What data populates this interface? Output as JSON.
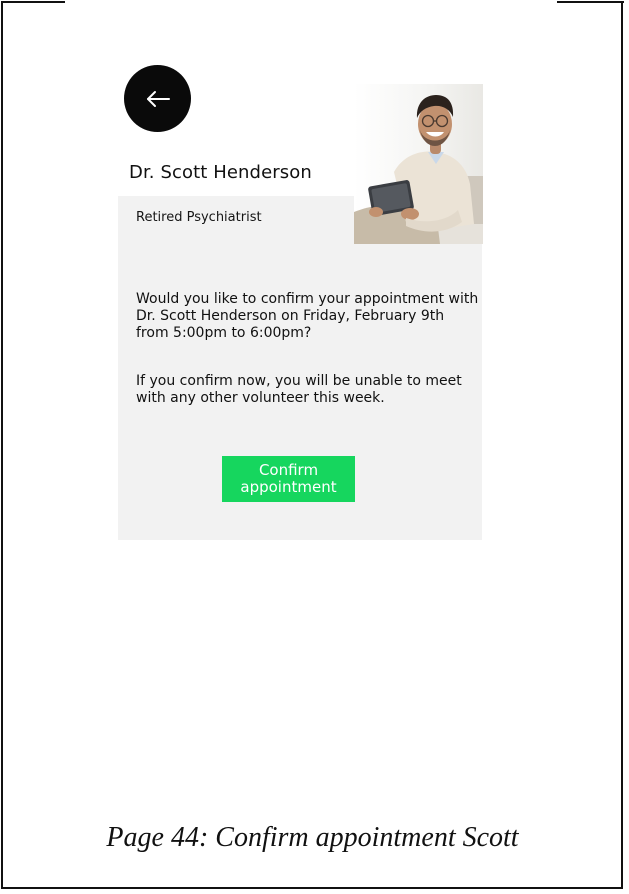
{
  "navigation": {
    "back_icon": "arrow-left-icon"
  },
  "profile": {
    "name": "Dr. Scott Henderson",
    "title": "Retired Psychiatrist",
    "photo_description_icon": "doctor-portrait-photo"
  },
  "confirmation": {
    "message": "Would you like to confirm your appointment with Dr. Scott Henderson on Friday, February 9th from 5:00pm to 6:00pm?",
    "warning": "If you confirm now, you will be unable to meet with any other volunteer this week.",
    "button_label": "Confirm appointment"
  },
  "caption": "Page 44: Confirm appointment Scott",
  "colors": {
    "accent": "#16d65e",
    "card_background": "#f2f2f2",
    "back_button": "#0a0a0a"
  }
}
